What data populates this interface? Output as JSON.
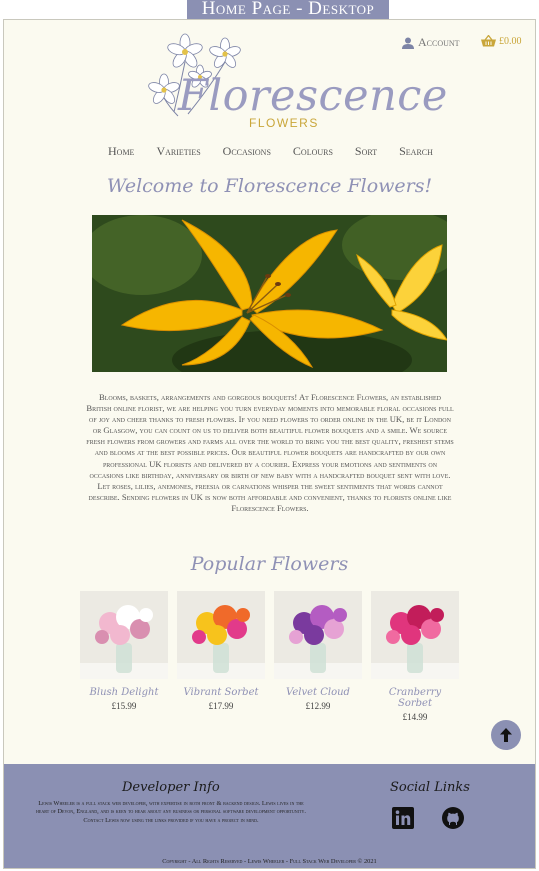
{
  "banner": "Home Page - Desktop",
  "logo": {
    "word": "Florescence",
    "sub": "FLOWERS"
  },
  "header": {
    "account": "Account",
    "basket_total": "£0.00"
  },
  "nav": [
    "Home",
    "Varieties",
    "Occasions",
    "Colours",
    "Sort",
    "Search"
  ],
  "welcome": "Welcome to Florescence Flowers!",
  "description": "Blooms, baskets, arrangements and gorgeous bouquets! At Florescence Flowers, an established British online florist, we are helping you turn everyday moments into memorable floral occasions full of joy and cheer thanks to fresh flowers. If you need flowers to order online in the UK, be it London or Glasgow, you can count on us to deliver both beautiful flower bouquets and a smile. We source fresh flowers from growers and farms all over the world to bring you the best quality, freshest stems and blooms at the best possible prices. Our beautiful flower bouquets are handcrafted by our own professional UK florists and delivered by a courier. Express your emotions and sentiments on occasions like birthday, anniversary or birth of new baby with a handcrafted bouquet sent with love. Let roses, lilies, anemones, freesia or carnations whisper the sweet sentiments that words cannot describe. Sending flowers in UK is now both affordable and convenient, thanks to florists online like Florescence Flowers.",
  "popular_title": "Popular Flowers",
  "products": [
    {
      "name": "Blush Delight",
      "price": "£15.99",
      "colors": [
        "#f2b8cf",
        "#ffffff",
        "#d98fb0"
      ]
    },
    {
      "name": "Vibrant Sorbet",
      "price": "£17.99",
      "colors": [
        "#f7c31c",
        "#f06a2a",
        "#e23a8a"
      ]
    },
    {
      "name": "Velvet Cloud",
      "price": "£12.99",
      "colors": [
        "#7a3a9e",
        "#b45cc2",
        "#e6a2d4"
      ]
    },
    {
      "name": "Cranberry Sorbet",
      "price": "£14.99",
      "colors": [
        "#e0357d",
        "#c21d5a",
        "#f06aa0"
      ]
    }
  ],
  "footer": {
    "dev_heading": "Developer Info",
    "dev_text": "Lewis Wheeler is a full stack web developer, with expertise in both front & backend design. Lewis lives in the heart of Devon, England, and is keen to hear about any business or personal software development opportunity. Contact Lewis now using the links provided if you have a project in mind.",
    "social_heading": "Social Links",
    "copyright": "Copyright - All Rights Reserved - Lewis Wheeler - Full Stack Web Developer © 2021"
  },
  "colors": {
    "accent": "#8b90b3",
    "gold": "#c9a63a",
    "background": "#fbfaf0"
  }
}
